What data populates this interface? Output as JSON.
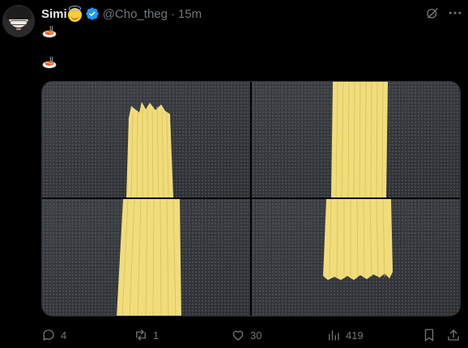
{
  "post": {
    "display_name": "Simi",
    "handle": "@Cho_theg",
    "separator": "·",
    "time": "15m",
    "name_emoji": "smiling-face-with-halo",
    "text_lines": [
      "spaghetti-emoji",
      "spaghetti-emoji"
    ]
  },
  "media": {
    "images": [
      {
        "subject": "uncooked spaghetti bundle on dark granite"
      },
      {
        "subject": "uncooked spaghetti bundle on dark granite"
      },
      {
        "subject": "uncooked spaghetti bundle on dark granite"
      },
      {
        "subject": "uncooked spaghetti bundle on dark granite"
      }
    ]
  },
  "actions": {
    "replies": "4",
    "reposts": "1",
    "likes": "30",
    "views": "419"
  },
  "colors": {
    "background": "#000000",
    "text": "#e7e9ea",
    "muted": "#71767b",
    "verified": "#1d9bf0",
    "spaghetti": "#f0dc7a"
  }
}
